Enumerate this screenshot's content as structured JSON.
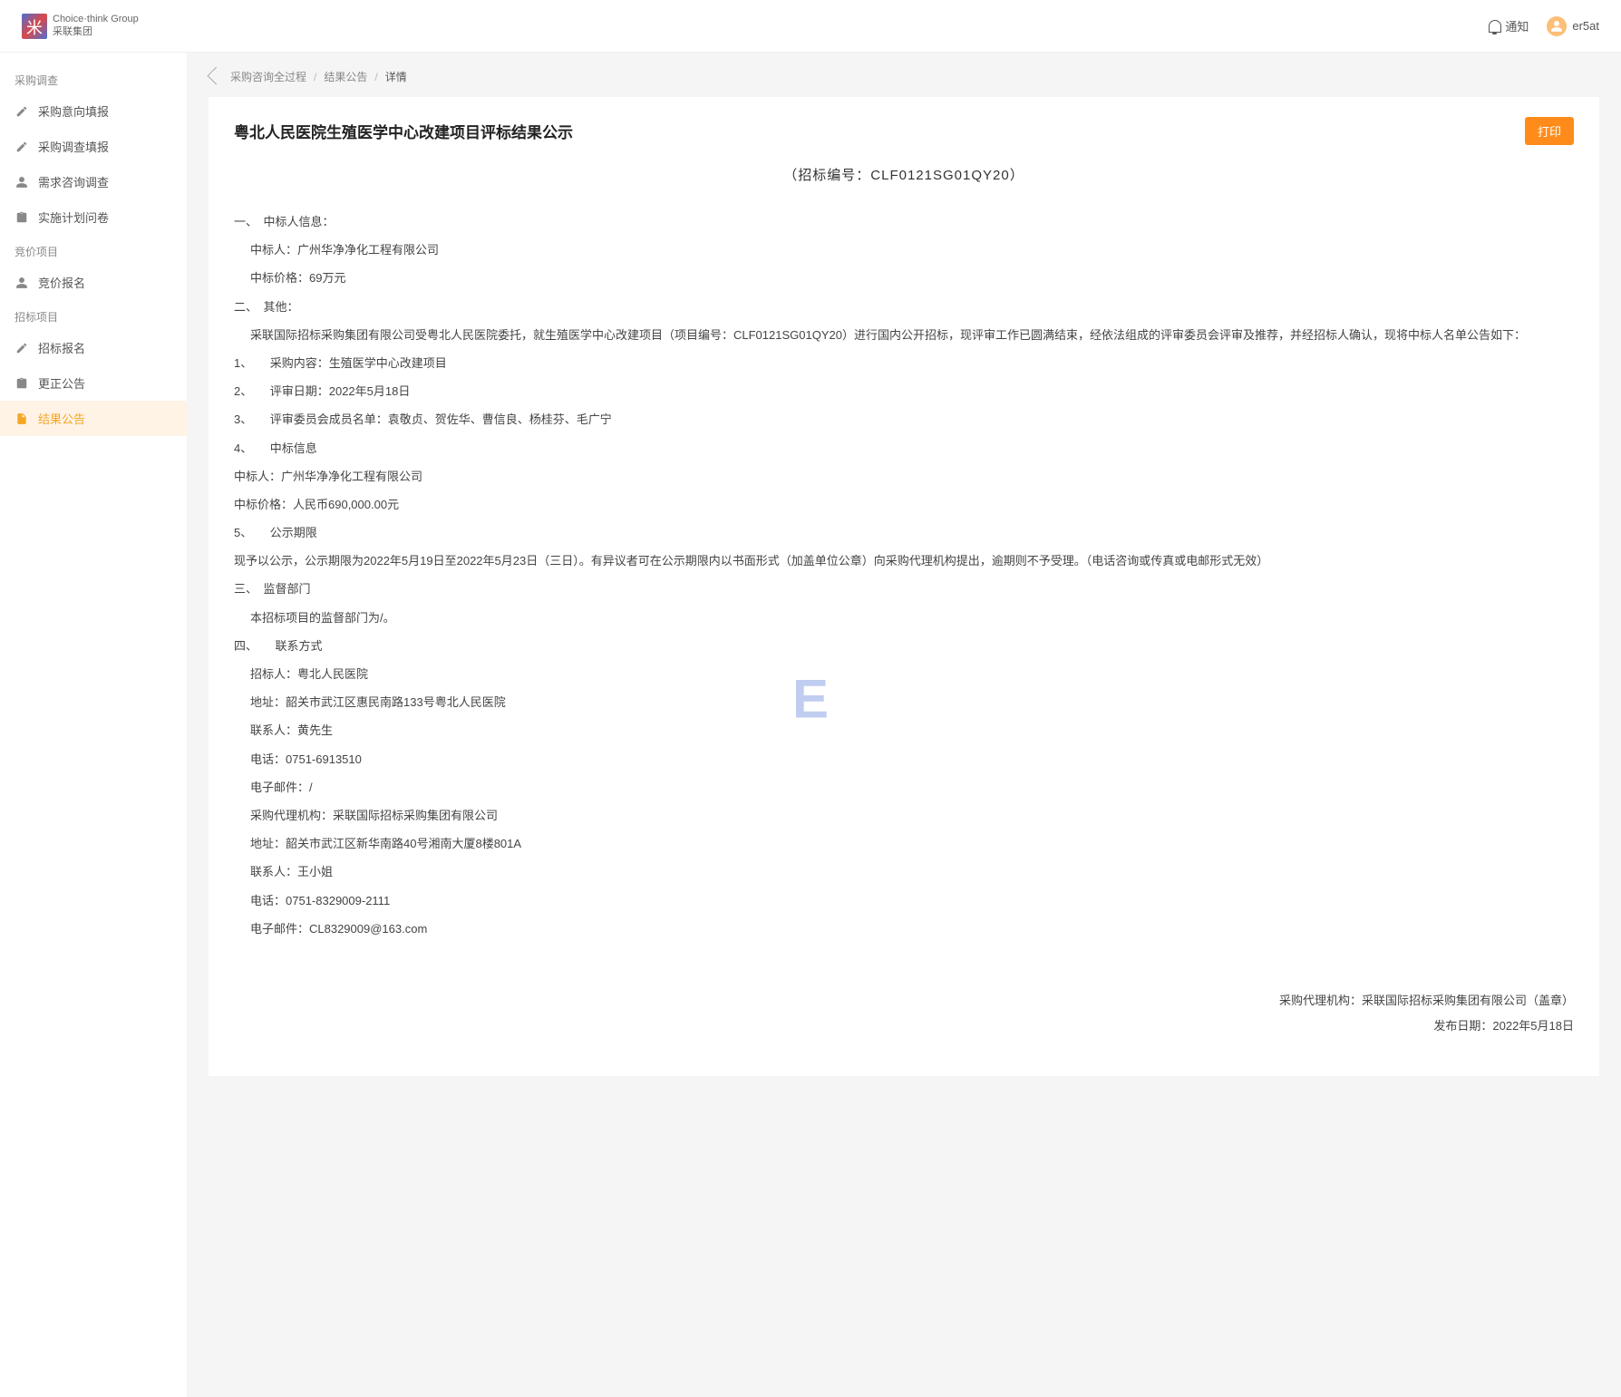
{
  "header": {
    "logo_line1": "Choice·think",
    "logo_line2": "Group",
    "logo_line3": "采联集团",
    "notif_label": "通知",
    "username": "er5at"
  },
  "sidebar": {
    "groups": [
      {
        "title": "采购调查",
        "items": [
          {
            "label": "采购意向填报",
            "icon": "pen"
          },
          {
            "label": "采购调查填报",
            "icon": "pen"
          },
          {
            "label": "需求咨询调查",
            "icon": "user"
          },
          {
            "label": "实施计划问卷",
            "icon": "clipboard"
          }
        ]
      },
      {
        "title": "竞价项目",
        "items": [
          {
            "label": "竞价报名",
            "icon": "user"
          }
        ]
      },
      {
        "title": "招标项目",
        "items": [
          {
            "label": "招标报名",
            "icon": "pen"
          },
          {
            "label": "更正公告",
            "icon": "clipboard"
          },
          {
            "label": "结果公告",
            "icon": "file",
            "active": true
          }
        ]
      }
    ]
  },
  "breadcrumb": {
    "items": [
      "采购咨询全过程",
      "结果公告",
      "详情"
    ]
  },
  "page": {
    "title": "粤北人民医院生殖医学中心改建项目评标结果公示",
    "print_label": "打印",
    "bid_code": "（招标编号：CLF0121SG01QY20）"
  },
  "content": {
    "s1_title": "一、　中标人信息：",
    "s1_p1": "中标人：广州华净净化工程有限公司",
    "s1_p2": "中标价格：69万元",
    "s2_title": "二、　其他：",
    "s2_p1": "采联国际招标采购集团有限公司受粤北人民医院委托，就生殖医学中心改建项目（项目编号：CLF0121SG01QY20）进行国内公开招标，现评审工作已圆满结束，经依法组成的评审委员会评审及推荐，并经招标人确认，现将中标人名单公告如下：",
    "li1": "1、　　采购内容：生殖医学中心改建项目",
    "li2": "2、　　评审日期：2022年5月18日",
    "li3": "3、　　评审委员会成员名单：袁敬贞、贺佐华、曹信良、杨桂芬、毛广宁",
    "li4": "4、　　中标信息",
    "li4_p1": "中标人：广州华净净化工程有限公司",
    "li4_p2": "中标价格：人民币690,000.00元",
    "li5": "5、　　公示期限",
    "li5_p1": "现予以公示，公示期限为2022年5月19日至2022年5月23日（三日）。有异议者可在公示期限内以书面形式（加盖单位公章）向采购代理机构提出，逾期则不予受理。（电话咨询或传真或电邮形式无效）",
    "s3_title": "三、　监督部门",
    "s3_p1": "本招标项目的监督部门为/。",
    "s4_title": "四、　　联系方式",
    "s4_p1": "招标人：粤北人民医院",
    "s4_p2": "地址：韶关市武江区惠民南路133号粤北人民医院",
    "s4_p3": "联系人：黄先生",
    "s4_p4": "电话：0751-6913510",
    "s4_p5": "电子邮件：/",
    "s4_p6": "采购代理机构：采联国际招标采购集团有限公司",
    "s4_p7": "地址：韶关市武江区新华南路40号湘南大厦8楼801A",
    "s4_p8": "联系人：王小姐",
    "s4_p9": "电话：0751-8329009-2111",
    "s4_p10": "电子邮件：CL8329009@163.com"
  },
  "footer": {
    "agency": "采购代理机构：采联国际招标采购集团有限公司（盖章）",
    "date": "发布日期：2022年5月18日"
  },
  "watermark": "E"
}
